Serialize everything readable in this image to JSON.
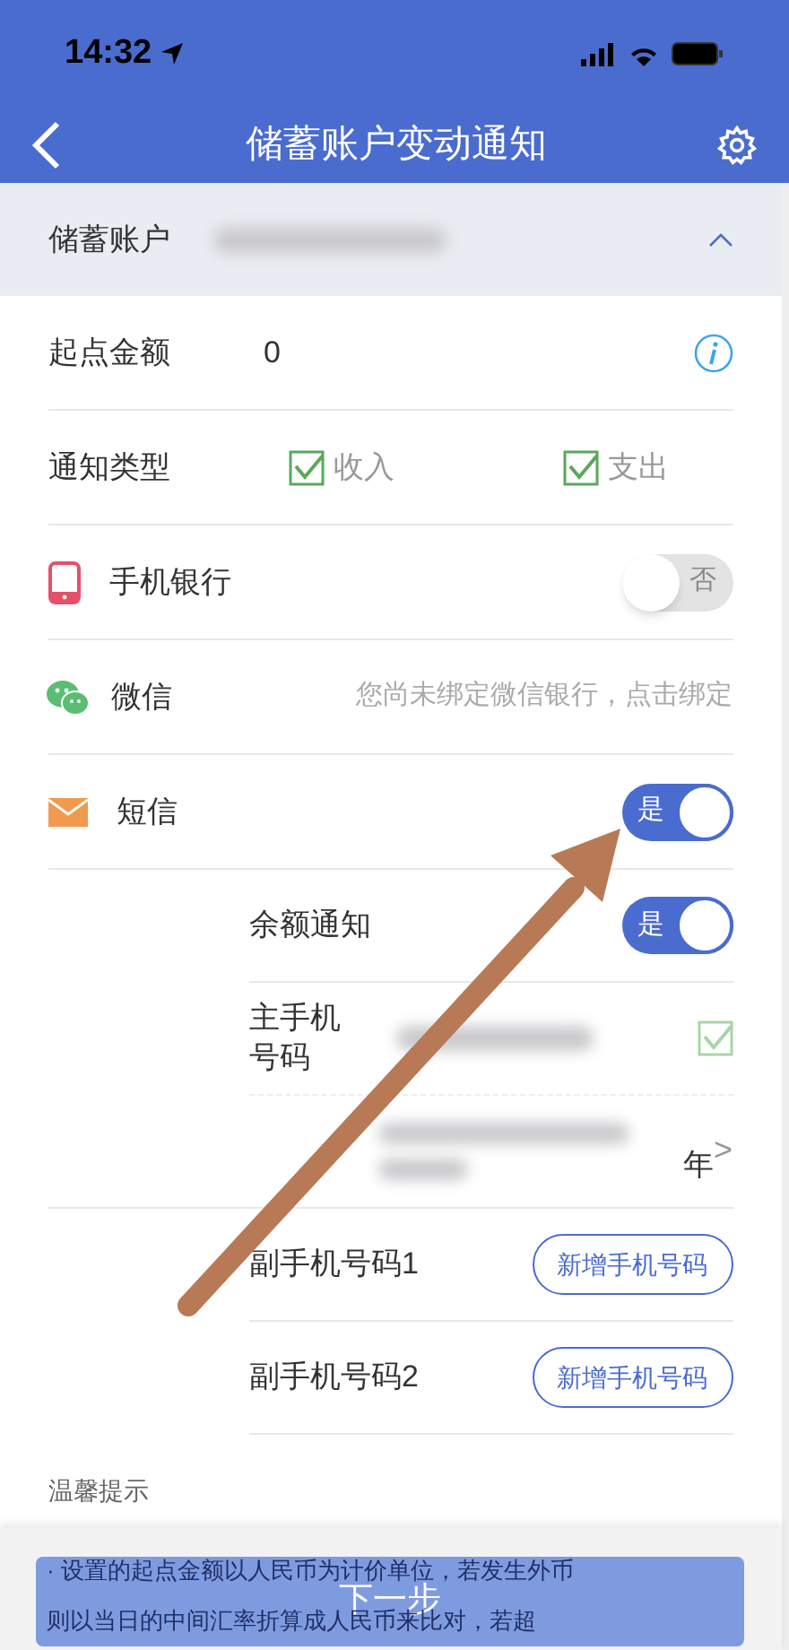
{
  "status_bar": {
    "time": "14:32"
  },
  "header": {
    "title": "储蓄账户变动通知"
  },
  "account": {
    "label": "储蓄账户",
    "expanded": true
  },
  "rows": [
    {
      "kind": "amount",
      "label": "起点金额",
      "value": "0"
    },
    {
      "kind": "types",
      "label": "通知类型",
      "options": [
        {
          "label": "收入",
          "checked": true
        },
        {
          "label": "支出",
          "checked": true
        }
      ]
    },
    {
      "kind": "app",
      "label": "手机银行",
      "on": false,
      "toggle_text": "否"
    },
    {
      "kind": "wechat",
      "label": "微信",
      "hint": "您尚未绑定微信银行，点击绑定"
    },
    {
      "kind": "sms",
      "label": "短信",
      "on": true,
      "toggle_text": "是"
    }
  ],
  "sms_settings": [
    {
      "kind": "toggle",
      "label": "余额通知",
      "on": true,
      "toggle_text": "是"
    },
    {
      "kind": "main_phone",
      "label": "主手机号码",
      "checked": true,
      "suffix": "年",
      "chevron": ">"
    },
    {
      "kind": "add",
      "label": "副手机号码1",
      "button": "新增手机号码"
    },
    {
      "kind": "add",
      "label": "副手机号码2",
      "button": "新增手机号码"
    }
  ],
  "tips": {
    "title": "温馨提示",
    "lines": [
      "· 设置的起点金额以人民币为计价单位，若发生外币",
      "则以当日的中间汇率折算成人民币来比对，若超"
    ]
  },
  "next_button": "下一步"
}
